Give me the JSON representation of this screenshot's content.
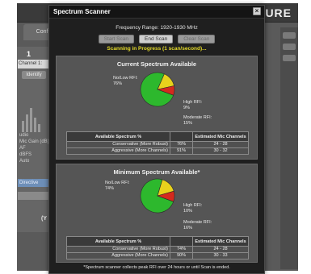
{
  "background_app": {
    "logo": "URE",
    "config_tab": "Confi",
    "channel_number": "1",
    "channel_label": "Channel 1:",
    "identify_button": "Identify",
    "audio_text": [
      "udio",
      "Mic Gain (dB)",
      "AF",
      "dBFS",
      "Auto"
    ],
    "blue_button": "Directive",
    "paren_text": "(Y"
  },
  "modal": {
    "title": "Spectrum Scanner",
    "close_label": "×",
    "frequency_range": "Frequency Range: 1920-1930 MHz",
    "buttons": {
      "start": "Start Scan",
      "end": "End Scan",
      "clear": "Clear Scan"
    },
    "status": "Scanning in Progress (1 scan/second)...",
    "footnote": "*Spectrum scanner collects peak RFI over 24 hours or until Scan is ended.",
    "colors": {
      "no_low": "#2db82d",
      "moderate": "#e8d21c",
      "high": "#d42a1e",
      "status_text": "#e6dc2a"
    }
  },
  "current": {
    "title": "Current Spectrum Available",
    "labels": {
      "no_low": [
        "No/Low RFI:",
        "76%"
      ],
      "high": [
        "High RFI:",
        "9%"
      ],
      "moderate": [
        "Moderate RFI:",
        "15%"
      ]
    },
    "table": {
      "headers": [
        "Available Spectrum %",
        "",
        "Estimated Mic Channels"
      ],
      "rows": [
        [
          "Conservative (More Robust)",
          "76%",
          "24 - 28"
        ],
        [
          "Aggressive (More Channels)",
          "91%",
          "30 - 32"
        ]
      ]
    }
  },
  "minimum": {
    "title": "Minimum Spectrum Available*",
    "labels": {
      "no_low": [
        "No/Low RFI:",
        "74%"
      ],
      "high": [
        "High RFI:",
        "10%"
      ],
      "moderate": [
        "Moderate RFI:",
        "16%"
      ]
    },
    "table": {
      "headers": [
        "Available Spectrum %",
        "",
        "Estimated Mic Channels"
      ],
      "rows": [
        [
          "Conservative (More Robust)",
          "74%",
          "24 - 28"
        ],
        [
          "Aggressive (More Channels)",
          "90%",
          "30 - 33"
        ]
      ]
    }
  },
  "chart_data": [
    {
      "type": "pie",
      "title": "Current Spectrum Available",
      "categories": [
        "No/Low RFI",
        "Moderate RFI",
        "High RFI"
      ],
      "values": [
        76,
        15,
        9
      ],
      "colors": [
        "#2db82d",
        "#e8d21c",
        "#d42a1e"
      ]
    },
    {
      "type": "pie",
      "title": "Minimum Spectrum Available*",
      "categories": [
        "No/Low RFI",
        "Moderate RFI",
        "High RFI"
      ],
      "values": [
        74,
        16,
        10
      ],
      "colors": [
        "#2db82d",
        "#e8d21c",
        "#d42a1e"
      ]
    }
  ]
}
